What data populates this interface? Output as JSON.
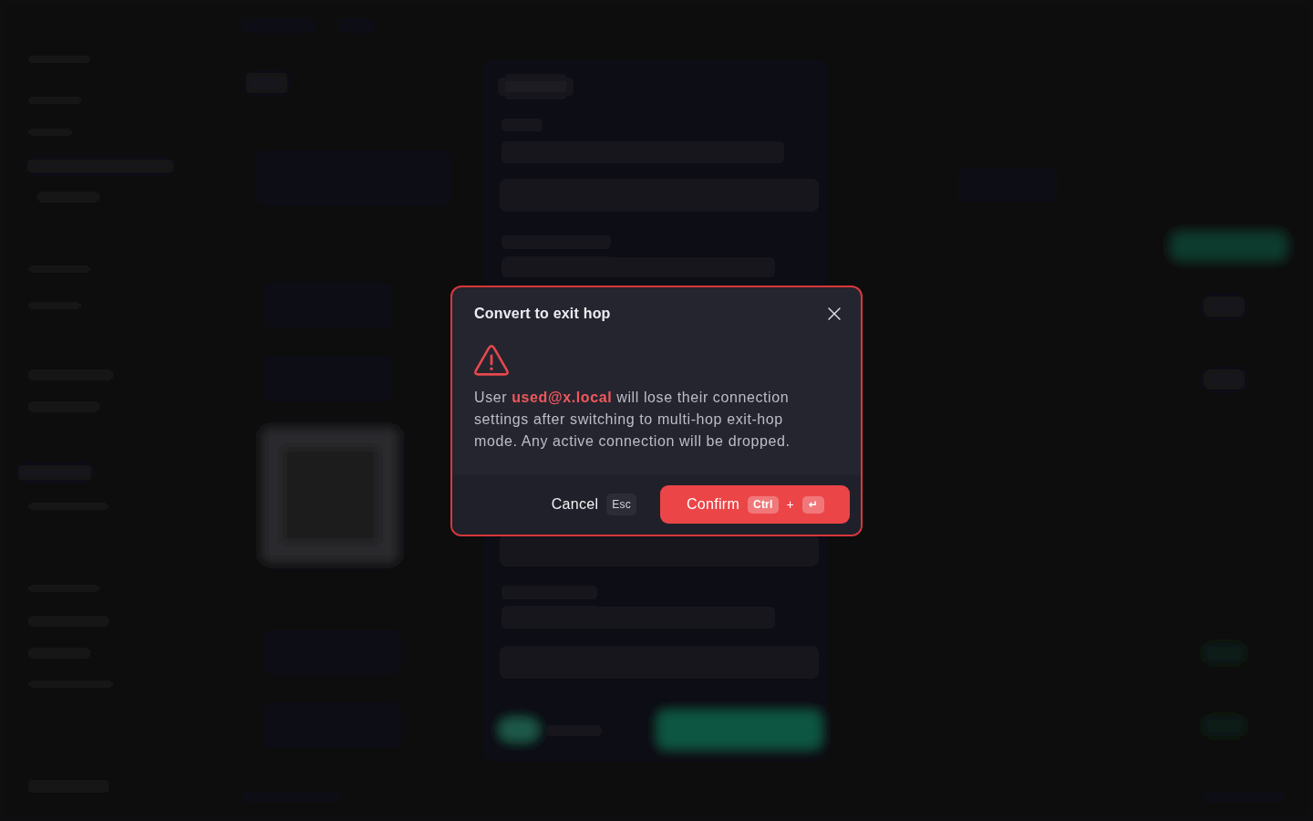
{
  "dialog": {
    "title": "Convert to exit hop",
    "message": "User **used@x.local** will lose their connection settings after switching to multi-hop exit-hop mode. Any active connection will be dropped.",
    "buttons": [
      {
        "kind": "secondary",
        "label": "Cancel",
        "shortcut": [
          {
            "kind": "key",
            "text": "Esc"
          }
        ]
      },
      {
        "kind": "danger",
        "label": "Confirm",
        "shortcut": [
          {
            "kind": "key",
            "text": "Ctrl"
          },
          {
            "kind": "plus",
            "text": "+"
          },
          {
            "kind": "key",
            "text": "↵"
          }
        ]
      }
    ]
  }
}
